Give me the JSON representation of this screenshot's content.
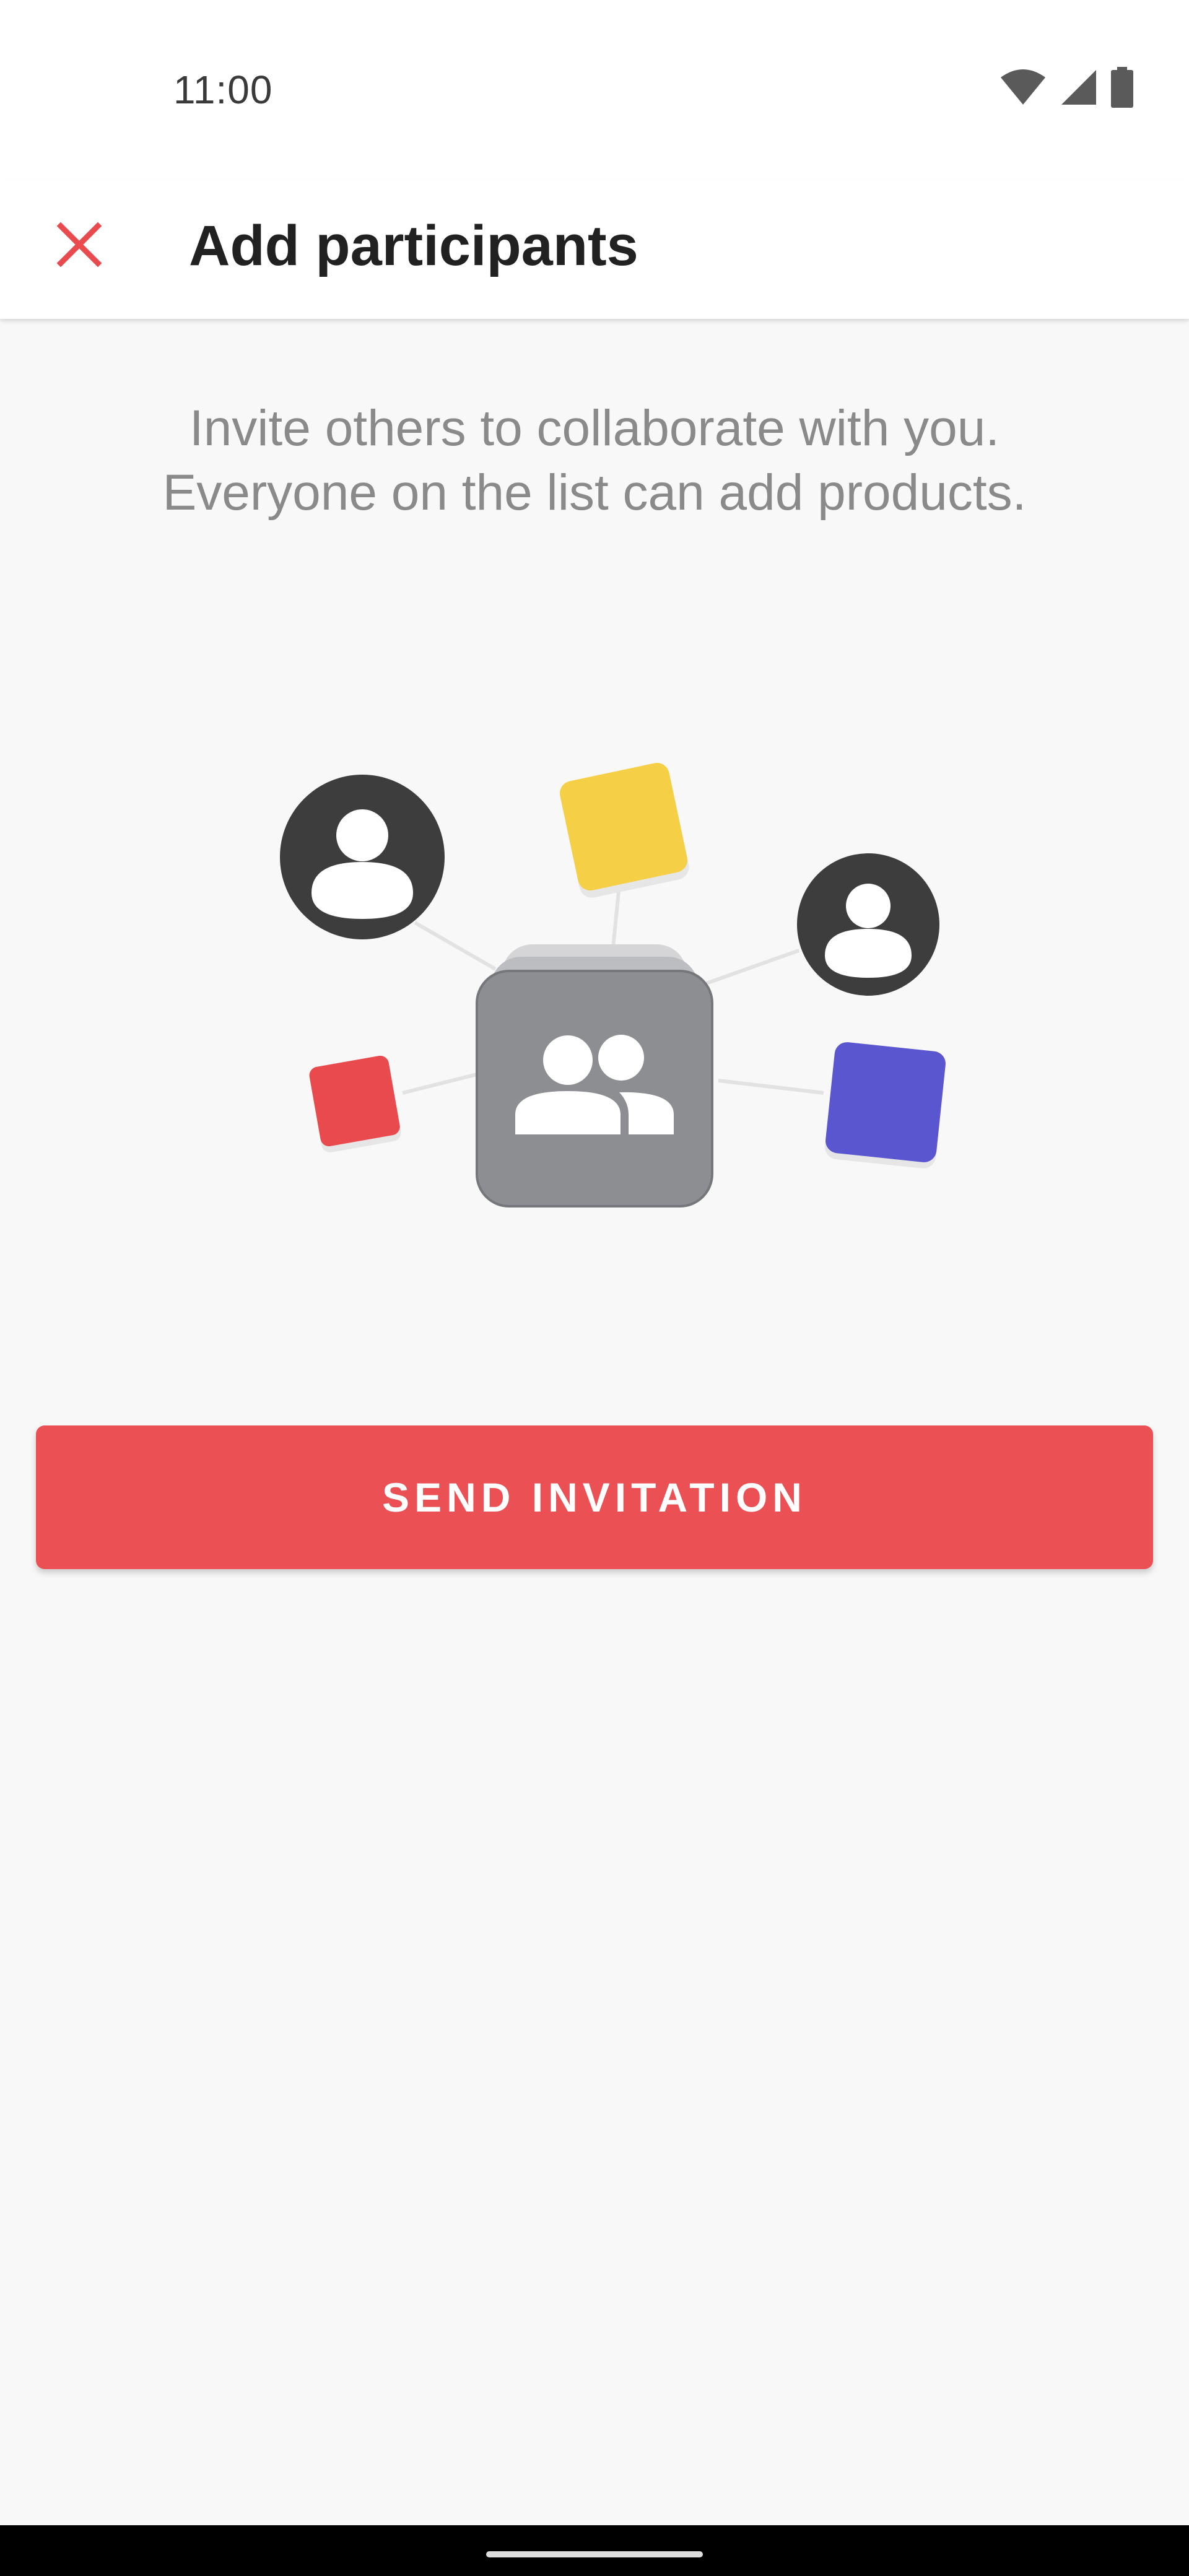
{
  "status_bar": {
    "time": "11:00",
    "icons": [
      "wifi-icon",
      "cellular-signal-icon",
      "battery-icon"
    ]
  },
  "app_bar": {
    "close_icon": "close-icon",
    "title": "Add participants"
  },
  "main": {
    "description_lines": [
      "Invite others to collaborate with you.",
      "Everyone on the list can add products."
    ],
    "illustration_icons": [
      "person-icon",
      "person-icon",
      "group-icon"
    ],
    "send_button_label": "SEND INVITATION"
  },
  "colors": {
    "accent": "#eb5154",
    "yellow_tile": "#f5cf45",
    "red_tile": "#e94a4e",
    "blue_tile": "#5956d0",
    "group_tile": "#8c8e92",
    "avatar": "#3d3d3d"
  }
}
